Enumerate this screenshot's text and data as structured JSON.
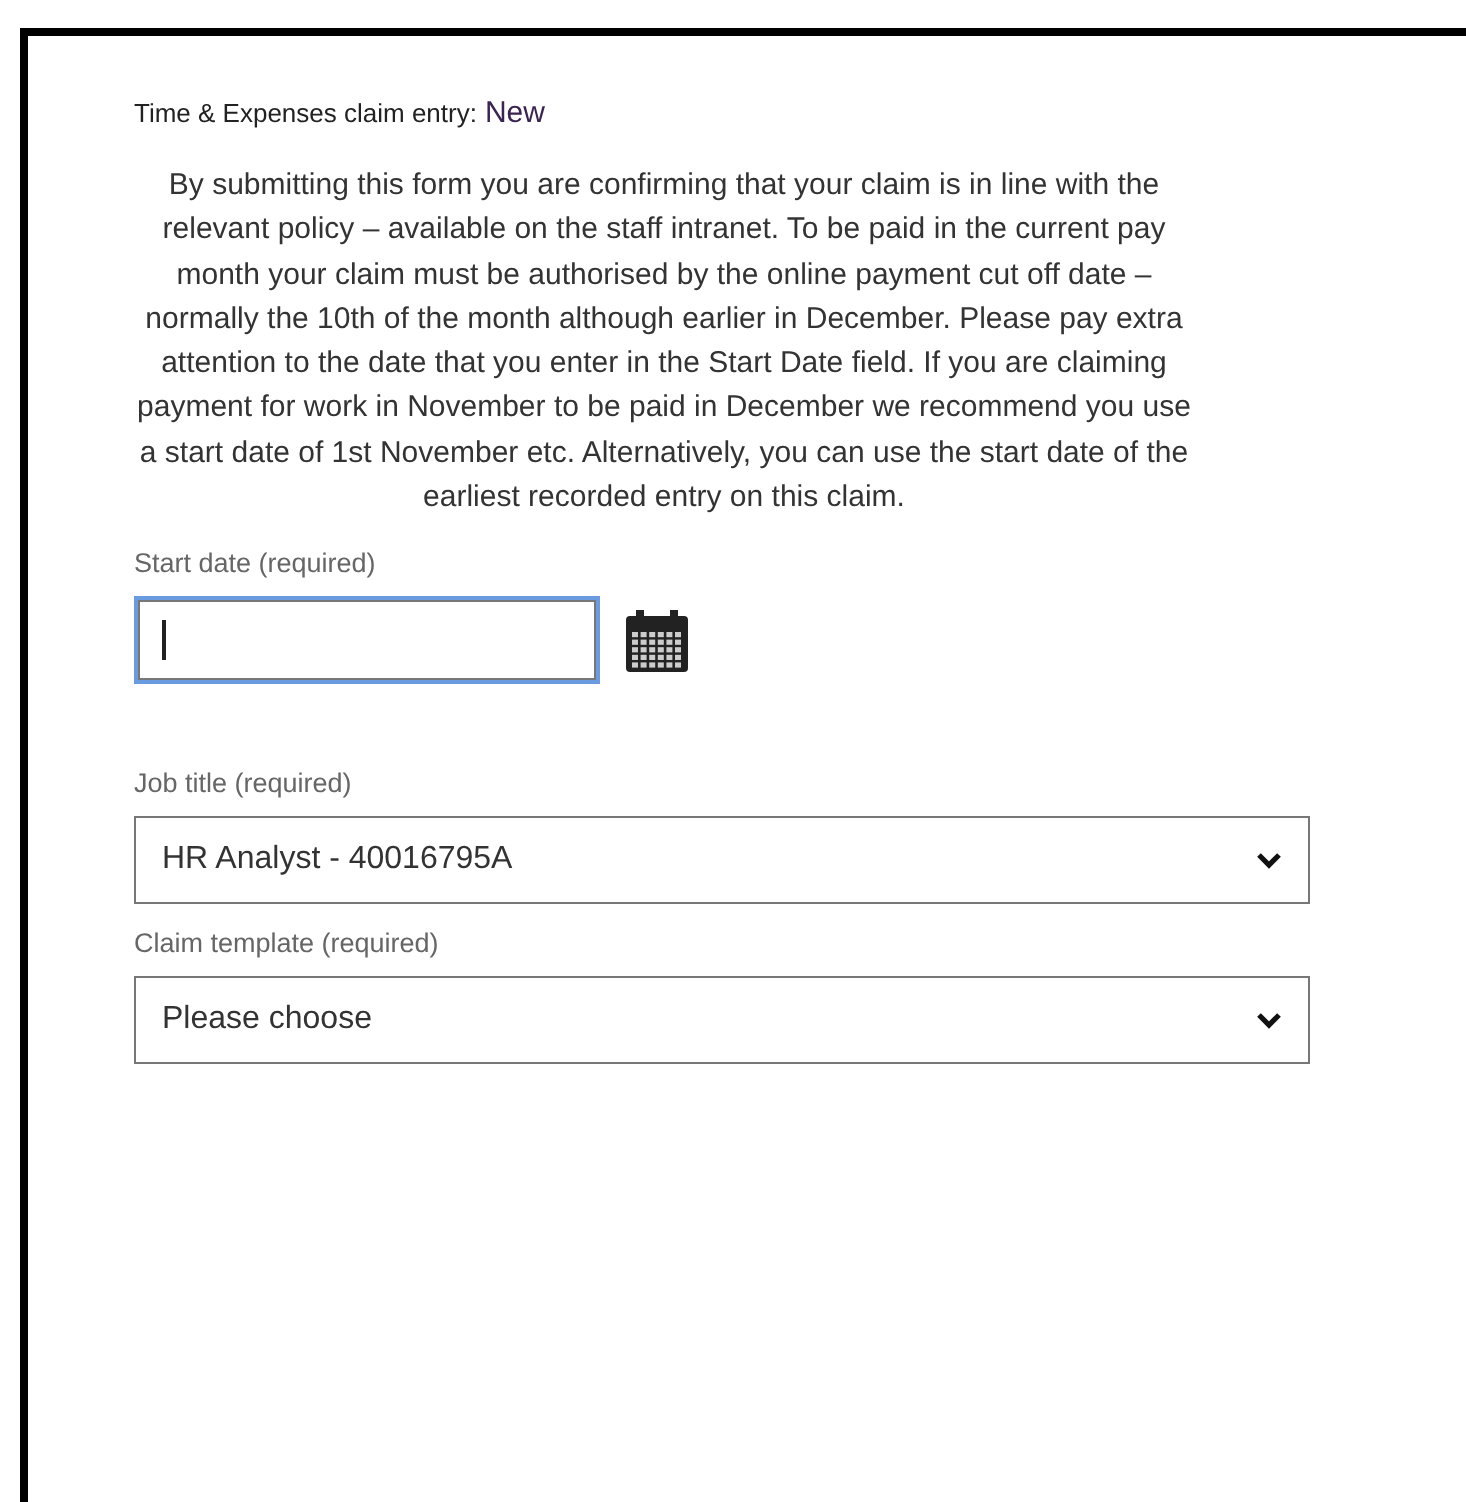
{
  "header": {
    "label": "Time & Expenses claim entry:",
    "value": "New"
  },
  "notice": "By submitting this form you are confirming that your claim is in line with the relevant policy – available on the staff intranet. To be paid in the current pay month your claim must be authorised by the online payment cut off date – normally the 10th of the month although earlier in December. Please pay extra attention to the date that you enter in the Start Date field. If you are claiming payment for work in November to be paid in December we recommend you use a start date of 1st November etc. Alternatively, you can use the start date of the earliest recorded entry on this claim.",
  "fields": [
    {
      "kind": "date",
      "label": "Start date (required)",
      "focused": true
    },
    {
      "kind": "select",
      "label": "Job title (required)",
      "value": "HR Analyst - 40016795A"
    },
    {
      "kind": "select",
      "label": "Claim template (required)",
      "value": "Please choose"
    }
  ]
}
